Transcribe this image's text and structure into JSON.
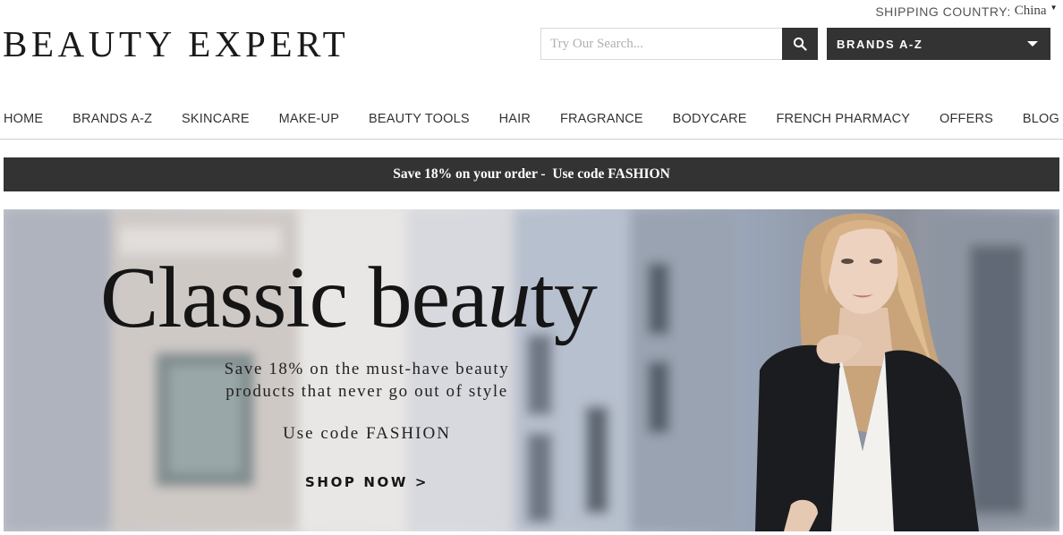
{
  "header": {
    "shipping_label": "SHIPPING COUNTRY:",
    "shipping_country": "China",
    "logo_text": "BEAUTY EXPERT",
    "search_placeholder": "Try Our Search...",
    "brands_dropdown_label": "BRANDS A-Z"
  },
  "nav": {
    "items": [
      {
        "label": "HOME"
      },
      {
        "label": "BRANDS A-Z"
      },
      {
        "label": "SKINCARE"
      },
      {
        "label": "MAKE-UP"
      },
      {
        "label": "BEAUTY TOOLS"
      },
      {
        "label": "HAIR"
      },
      {
        "label": "FRAGRANCE"
      },
      {
        "label": "BODYCARE"
      },
      {
        "label": "FRENCH PHARMACY"
      },
      {
        "label": "OFFERS"
      },
      {
        "label": "BLOG"
      }
    ]
  },
  "promo_bar": {
    "text": "Save 18% on your order -  Use code FASHION"
  },
  "hero": {
    "title_start": "Classic bea",
    "title_italic": "u",
    "title_end": "ty",
    "subtitle_line1": "Save 18% on the must-have beauty",
    "subtitle_line2": "products that never go out of style",
    "code_text": "Use code FASHION",
    "cta_label": "SHOP NOW >"
  },
  "colors": {
    "dark_bar": "#333333",
    "text_primary": "#222222",
    "nav_divider": "#cfcfcf"
  },
  "icons": {
    "search": "search-icon",
    "dropdown": "chevron-down-icon",
    "shipping_caret": "caret-down-icon"
  }
}
